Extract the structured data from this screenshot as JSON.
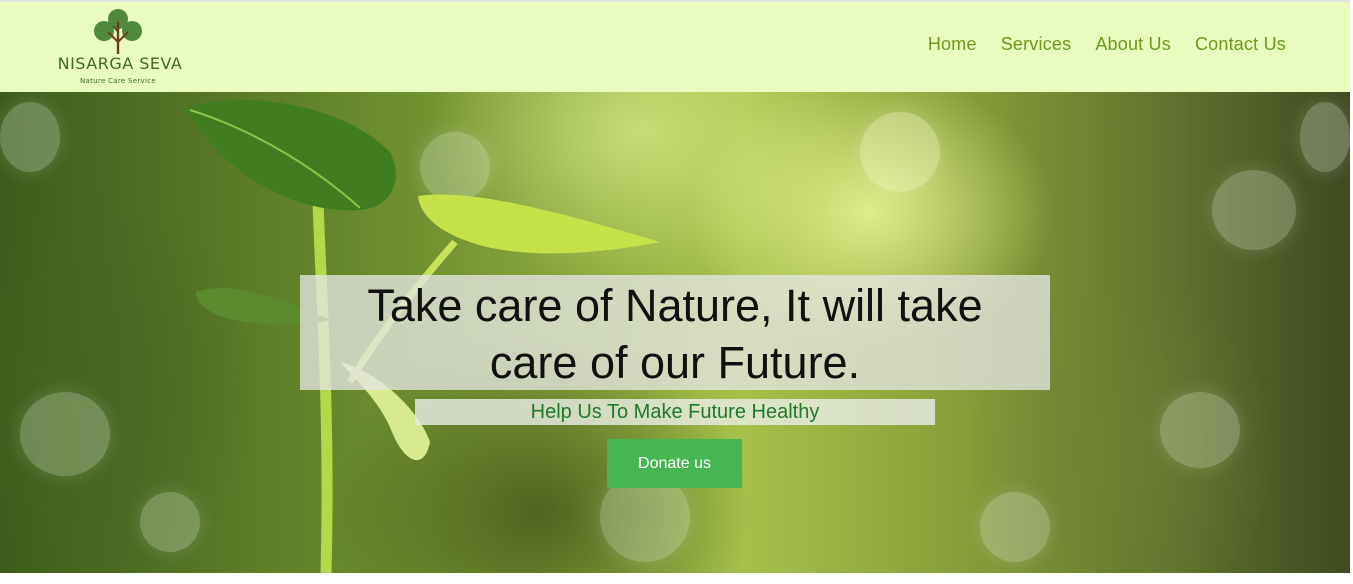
{
  "brand": {
    "name": "NISARGA SEVA",
    "tagline": "Nature Care Service",
    "logo_icon": "tree-icon",
    "colors": {
      "header_bg": "#e9fcbd",
      "nav_text": "#6a9a1d",
      "logo_text": "#3f6a28",
      "button_bg": "#47b550"
    }
  },
  "nav": {
    "items": [
      {
        "label": "Home"
      },
      {
        "label": "Services"
      },
      {
        "label": "About Us"
      },
      {
        "label": "Contact Us"
      }
    ]
  },
  "hero": {
    "headline_line1": "Take care of Nature, It will take",
    "headline_line2": "care of our Future.",
    "subheadline": "Help Us To Make Future Healthy",
    "cta_label": "Donate us",
    "background": "sprout-photo"
  }
}
